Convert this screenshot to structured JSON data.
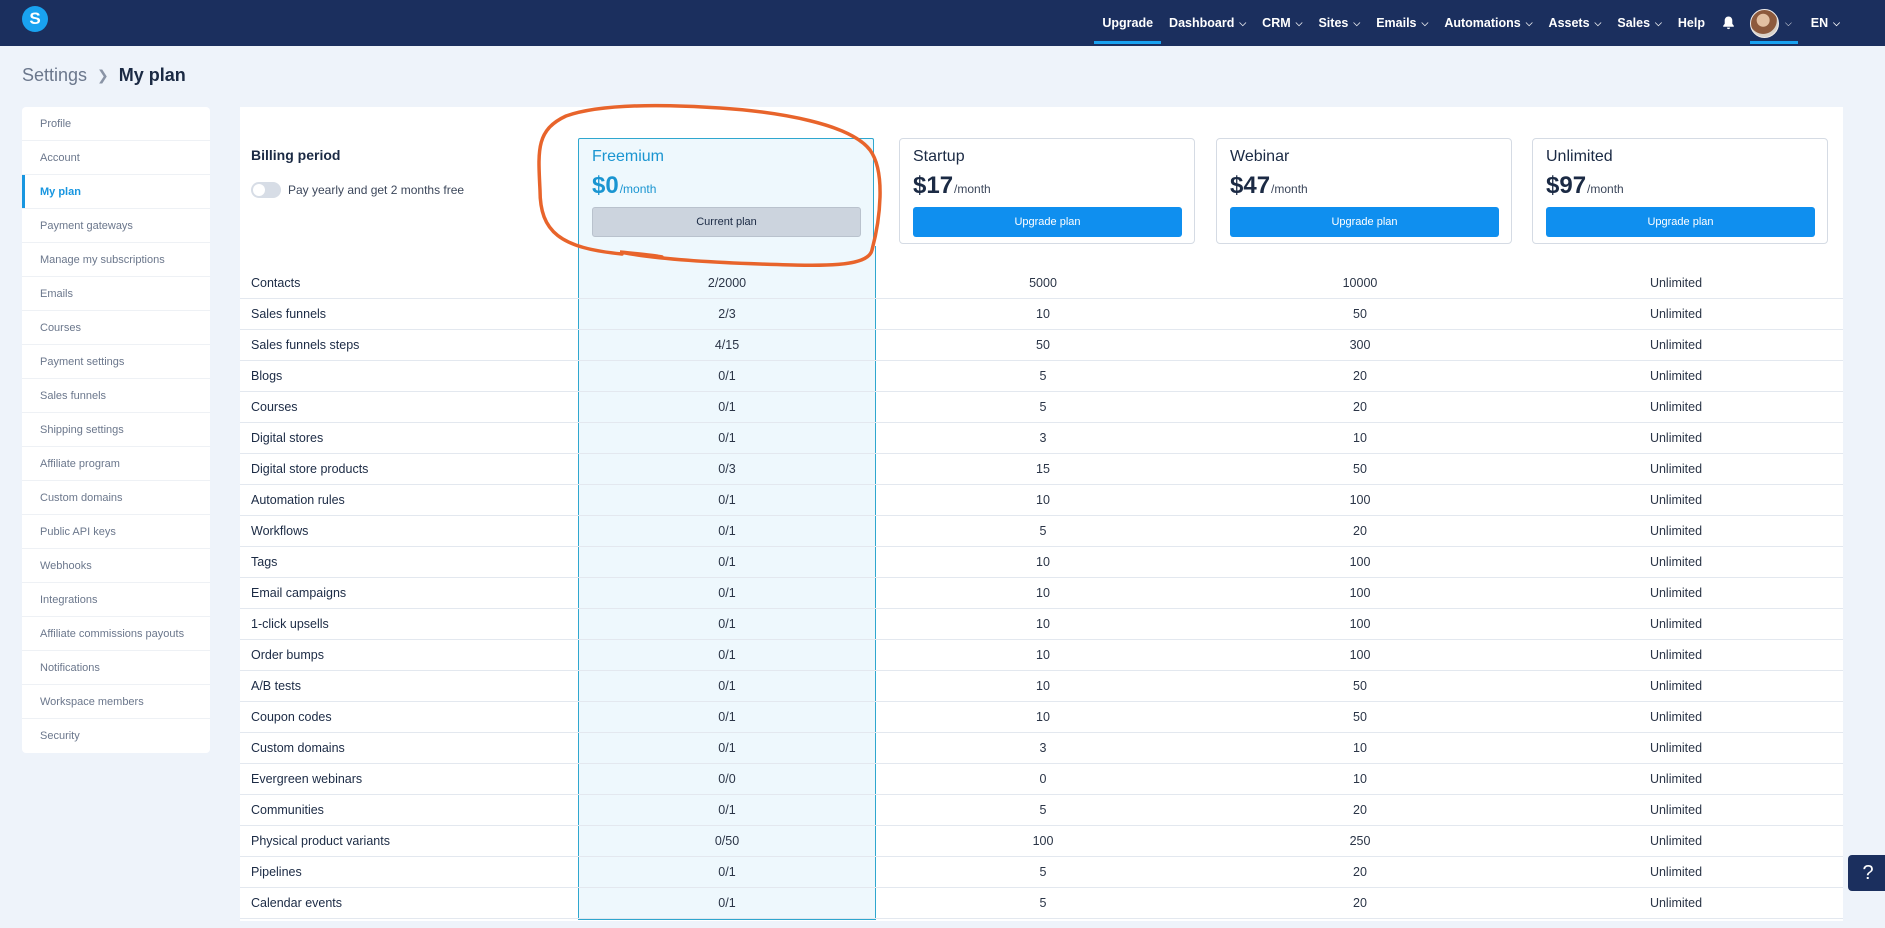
{
  "nav": {
    "logo": "S",
    "items": [
      {
        "label": "Upgrade",
        "dropdown": false,
        "active": true
      },
      {
        "label": "Dashboard",
        "dropdown": true
      },
      {
        "label": "CRM",
        "dropdown": true
      },
      {
        "label": "Sites",
        "dropdown": true
      },
      {
        "label": "Emails",
        "dropdown": true
      },
      {
        "label": "Automations",
        "dropdown": true
      },
      {
        "label": "Assets",
        "dropdown": true
      },
      {
        "label": "Sales",
        "dropdown": true
      },
      {
        "label": "Help",
        "dropdown": false
      }
    ],
    "bell_icon": "bell-icon",
    "language": "EN"
  },
  "breadcrumb": {
    "parent": "Settings",
    "current": "My plan"
  },
  "sidebar": {
    "items": [
      {
        "label": "Profile"
      },
      {
        "label": "Account"
      },
      {
        "label": "My plan",
        "active": true
      },
      {
        "label": "Payment gateways"
      },
      {
        "label": "Manage my subscriptions"
      },
      {
        "label": "Emails"
      },
      {
        "label": "Courses"
      },
      {
        "label": "Payment settings"
      },
      {
        "label": "Sales funnels"
      },
      {
        "label": "Shipping settings"
      },
      {
        "label": "Affiliate program"
      },
      {
        "label": "Custom domains"
      },
      {
        "label": "Public API keys"
      },
      {
        "label": "Webhooks"
      },
      {
        "label": "Integrations"
      },
      {
        "label": "Affiliate commissions payouts"
      },
      {
        "label": "Notifications"
      },
      {
        "label": "Workspace members"
      },
      {
        "label": "Security"
      }
    ]
  },
  "billing": {
    "title": "Billing period",
    "toggle_label": "Pay yearly and get 2 months free",
    "yearly": false
  },
  "plans": [
    {
      "name": "Freemium",
      "price": "$0",
      "unit": "/month",
      "button": "Current plan",
      "current": true
    },
    {
      "name": "Startup",
      "price": "$17",
      "unit": "/month",
      "button": "Upgrade plan"
    },
    {
      "name": "Webinar",
      "price": "$47",
      "unit": "/month",
      "button": "Upgrade plan"
    },
    {
      "name": "Unlimited",
      "price": "$97",
      "unit": "/month",
      "button": "Upgrade plan"
    }
  ],
  "features": [
    {
      "name": "Contacts",
      "values": [
        "2/2000",
        "5000",
        "10000",
        "Unlimited"
      ]
    },
    {
      "name": "Sales funnels",
      "values": [
        "2/3",
        "10",
        "50",
        "Unlimited"
      ]
    },
    {
      "name": "Sales funnels steps",
      "values": [
        "4/15",
        "50",
        "300",
        "Unlimited"
      ]
    },
    {
      "name": "Blogs",
      "values": [
        "0/1",
        "5",
        "20",
        "Unlimited"
      ]
    },
    {
      "name": "Courses",
      "values": [
        "0/1",
        "5",
        "20",
        "Unlimited"
      ]
    },
    {
      "name": "Digital stores",
      "values": [
        "0/1",
        "3",
        "10",
        "Unlimited"
      ]
    },
    {
      "name": "Digital store products",
      "values": [
        "0/3",
        "15",
        "50",
        "Unlimited"
      ]
    },
    {
      "name": "Automation rules",
      "values": [
        "0/1",
        "10",
        "100",
        "Unlimited"
      ]
    },
    {
      "name": "Workflows",
      "values": [
        "0/1",
        "5",
        "20",
        "Unlimited"
      ]
    },
    {
      "name": "Tags",
      "values": [
        "0/1",
        "10",
        "100",
        "Unlimited"
      ]
    },
    {
      "name": "Email campaigns",
      "values": [
        "0/1",
        "10",
        "100",
        "Unlimited"
      ]
    },
    {
      "name": "1-click upsells",
      "values": [
        "0/1",
        "10",
        "100",
        "Unlimited"
      ]
    },
    {
      "name": "Order bumps",
      "values": [
        "0/1",
        "10",
        "100",
        "Unlimited"
      ]
    },
    {
      "name": "A/B tests",
      "values": [
        "0/1",
        "10",
        "50",
        "Unlimited"
      ]
    },
    {
      "name": "Coupon codes",
      "values": [
        "0/1",
        "10",
        "50",
        "Unlimited"
      ]
    },
    {
      "name": "Custom domains",
      "values": [
        "0/1",
        "3",
        "10",
        "Unlimited"
      ]
    },
    {
      "name": "Evergreen webinars",
      "values": [
        "0/0",
        "0",
        "10",
        "Unlimited"
      ]
    },
    {
      "name": "Communities",
      "values": [
        "0/1",
        "5",
        "20",
        "Unlimited"
      ]
    },
    {
      "name": "Physical product variants",
      "values": [
        "0/50",
        "100",
        "250",
        "Unlimited"
      ]
    },
    {
      "name": "Pipelines",
      "values": [
        "0/1",
        "5",
        "20",
        "Unlimited"
      ]
    },
    {
      "name": "Calendar events",
      "values": [
        "0/1",
        "5",
        "20",
        "Unlimited"
      ]
    }
  ],
  "help": {
    "label": "?"
  },
  "colors": {
    "nav_bg": "#1b2f5e",
    "accent": "#19a2f0",
    "button": "#0f8fef",
    "annotation": "#e8642b"
  }
}
